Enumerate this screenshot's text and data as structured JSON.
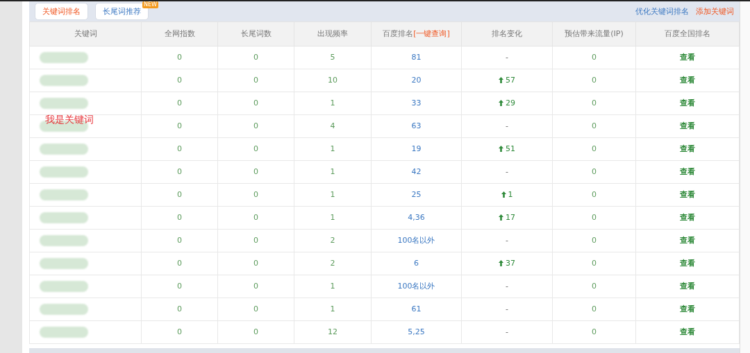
{
  "tabs": [
    {
      "label": "关键词排名",
      "selected": true
    },
    {
      "label": "长尾词推荐",
      "selected": false,
      "badge": "NEW"
    }
  ],
  "links": [
    {
      "label": "优化关键词排名",
      "kind": "normal"
    },
    {
      "label": "添加关键词",
      "kind": "accent"
    }
  ],
  "table": {
    "columns": [
      "关键词",
      "全网指数",
      "长尾词数",
      "出现频率",
      "百度排名[一键查询]",
      "排名变化",
      "预估带来流量(IP)",
      "百度全国排名"
    ],
    "rows": [
      {
        "index": "0",
        "longtail": "0",
        "frequency": "5",
        "rank": "81",
        "change": {
          "kind": "none",
          "value": "-"
        },
        "traffic": "0",
        "action": "查看"
      },
      {
        "index": "0",
        "longtail": "0",
        "frequency": "10",
        "rank": "20",
        "change": {
          "kind": "up",
          "value": "57"
        },
        "traffic": "0",
        "action": "查看"
      },
      {
        "index": "0",
        "longtail": "0",
        "frequency": "1",
        "rank": "33",
        "change": {
          "kind": "up",
          "value": "29"
        },
        "traffic": "0",
        "action": "查看"
      },
      {
        "index": "0",
        "longtail": "0",
        "frequency": "4",
        "rank": "63",
        "change": {
          "kind": "none",
          "value": "-"
        },
        "traffic": "0",
        "action": "查看",
        "annotation": "我是关键词"
      },
      {
        "index": "0",
        "longtail": "0",
        "frequency": "1",
        "rank": "19",
        "change": {
          "kind": "up",
          "value": "51"
        },
        "traffic": "0",
        "action": "查看"
      },
      {
        "index": "0",
        "longtail": "0",
        "frequency": "1",
        "rank": "42",
        "change": {
          "kind": "none",
          "value": "-"
        },
        "traffic": "0",
        "action": "查看"
      },
      {
        "index": "0",
        "longtail": "0",
        "frequency": "1",
        "rank": "25",
        "change": {
          "kind": "up",
          "value": "1"
        },
        "traffic": "0",
        "action": "查看"
      },
      {
        "index": "0",
        "longtail": "0",
        "frequency": "1",
        "rank": "4,36",
        "change": {
          "kind": "up",
          "value": "17"
        },
        "traffic": "0",
        "action": "查看"
      },
      {
        "index": "0",
        "longtail": "0",
        "frequency": "2",
        "rank": "100名以外",
        "change": {
          "kind": "none",
          "value": "-"
        },
        "traffic": "0",
        "action": "查看"
      },
      {
        "index": "0",
        "longtail": "0",
        "frequency": "2",
        "rank": "6",
        "change": {
          "kind": "up",
          "value": "37"
        },
        "traffic": "0",
        "action": "查看"
      },
      {
        "index": "0",
        "longtail": "0",
        "frequency": "1",
        "rank": "100名以外",
        "change": {
          "kind": "none",
          "value": "-"
        },
        "traffic": "0",
        "action": "查看"
      },
      {
        "index": "0",
        "longtail": "0",
        "frequency": "1",
        "rank": "61",
        "change": {
          "kind": "none",
          "value": "-"
        },
        "traffic": "0",
        "action": "查看"
      },
      {
        "index": "0",
        "longtail": "0",
        "frequency": "12",
        "rank": "5,25",
        "change": {
          "kind": "none",
          "value": "-"
        },
        "traffic": "0",
        "action": "查看"
      }
    ]
  }
}
